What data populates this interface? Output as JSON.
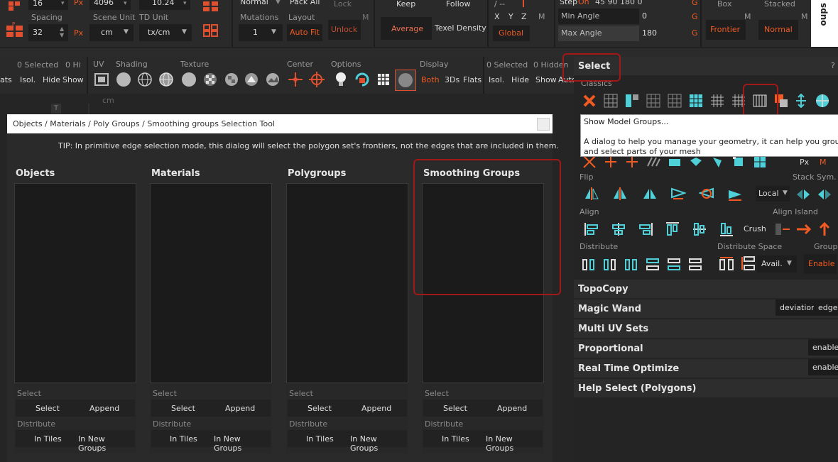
{
  "colors": {
    "accent": "#f15a22",
    "highlight_box": "#a01818",
    "cyan_icon": "#4fd0d8"
  },
  "top": {
    "field_16": "16",
    "px1": "Px",
    "field_4096": "4096",
    "field_1024": "10.24",
    "spacing_label": "Spacing",
    "spacing_value": "32",
    "px2": "Px",
    "scene_unit_label": "Scene Unit",
    "scene_unit_value": "cm",
    "td_unit_label": "TD Unit",
    "td_unit_value": "tx/cm",
    "normal": "Normal",
    "pack_all": "Pack All",
    "mutations_label": "Mutations",
    "mutations_value": "1",
    "layout_label": "Layout",
    "auto_fit": "Auto Fit",
    "lock": "Lock",
    "m1": "M",
    "unlock": "Unlock",
    "keep": "Keep",
    "follow": "Follow",
    "average": "Average",
    "texel_density": "Texel Density",
    "x": "X",
    "y": "Y",
    "z": "Z",
    "m2": "M",
    "global": "Global",
    "step": "Step",
    "step_on": "On",
    "angles": "45  90  180  0",
    "min_angle_label": "Min Angle",
    "min_angle_value": "0",
    "max_angle_label": "Max Angle",
    "max_angle_value": "180",
    "g1": "G",
    "g2": "G",
    "g3": "G",
    "box": "Box",
    "frontier": "Frontier",
    "m3": "M",
    "stacked": "Stacked",
    "normal2": "Normal",
    "m4": "M",
    "side_text": "oups"
  },
  "row2": {
    "selected_left": "0 Selected",
    "hi_left": "0 Hi",
    "ats": "ats",
    "isol1": "Isol.",
    "hide1": "Hide",
    "show1": "Show",
    "uv": "UV",
    "shading": "Shading",
    "texture": "Texture",
    "center": "Center",
    "options": "Options",
    "display": "Display",
    "both": "Both",
    "threeds": "3Ds",
    "flats": "Flats",
    "selected_right": "0 Selected",
    "hidden_right": "0 Hidden",
    "isol2": "Isol.",
    "hide2": "Hide",
    "show2": "Show",
    "auto": "Auto",
    "cm": "cm",
    "t_icon_label": "T"
  },
  "dialog": {
    "title": "Objects / Materials / Poly Groups / Smoothing groups Selection Tool",
    "tip": "TIP: In primitive edge selection mode, this dialog will select the polygon set's frontiers, not the edges that are included in them.",
    "columns": [
      {
        "name": "Objects"
      },
      {
        "name": "Materials"
      },
      {
        "name": "Polygroups"
      },
      {
        "name": "Smoothing Groups"
      }
    ],
    "select_label": "Select",
    "select_btn": "Select",
    "append_btn": "Append",
    "distribute_label": "Distribute",
    "in_tiles": "In Tiles",
    "in_new_groups": "In New Groups"
  },
  "panel": {
    "select_title": "Select",
    "question": "?",
    "classics": "Classics",
    "px": "Px",
    "m": "M",
    "flip": "Flip",
    "stack_sym": "Stack Sym.",
    "local": "Local",
    "align": "Align",
    "align_island": "Align Island",
    "crush": "Crush",
    "distribute": "Distribute",
    "distribute_space": "Distribute Space",
    "group": "Group",
    "avail": "Avail.",
    "enable_orange": "Enable",
    "topocopy": "TopoCopy",
    "magic_wand": "Magic Wand",
    "deviation": "deviation",
    "edge": "edge",
    "multi_uv_sets": "Multi UV Sets",
    "proportional": "Proportional",
    "enable1": "enable",
    "real_time_optimize": "Real Time Optimize",
    "enable2": "enable",
    "help_select": "Help Select (Polygons)"
  },
  "tooltip": {
    "title": "Show Model Groups...",
    "line1": "A dialog to help you manage your geometry, it can help you group, tile,",
    "line2": "and select parts of your mesh"
  }
}
